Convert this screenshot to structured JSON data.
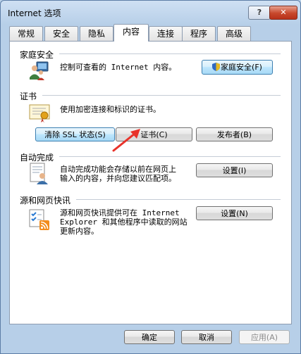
{
  "window": {
    "title": "Internet 选项"
  },
  "titlebar": {
    "help_glyph": "?",
    "close_glyph": "✕"
  },
  "tabs": [
    {
      "label": "常规"
    },
    {
      "label": "安全"
    },
    {
      "label": "隐私"
    },
    {
      "label": "内容",
      "active": true
    },
    {
      "label": "连接"
    },
    {
      "label": "程序"
    },
    {
      "label": "高级"
    }
  ],
  "sections": {
    "family_safety": {
      "title": "家庭安全",
      "description": "控制可查看的 Internet 内容。",
      "button": "家庭安全(F)",
      "icon": "family-safety-icon"
    },
    "certificates": {
      "title": "证书",
      "description": "使用加密连接和标识的证书。",
      "clear_ssl_button": "清除 SSL 状态(S)",
      "certificates_button": "证书(C)",
      "publishers_button": "发布者(B)",
      "icon": "certificate-icon"
    },
    "autocomplete": {
      "title": "自动完成",
      "description_line1": "自动完成功能会存储以前在网页上",
      "description_line2": "输入的内容，并向您建议匹配项。",
      "settings_button": "设置(I)",
      "icon": "autocomplete-icon"
    },
    "feeds": {
      "title": "源和网页快讯",
      "description_line1": "源和网页快讯提供可在 Internet",
      "description_line2": "Explorer 和其他程序中读取的网站",
      "description_line3": "更新内容。",
      "settings_button": "设置(N)",
      "icon": "feed-icon"
    }
  },
  "footer": {
    "ok_button": "确定",
    "cancel_button": "取消",
    "apply_button": "应用(A)"
  },
  "colors": {
    "accent": "#3c7fb1",
    "annotation_arrow": "#e8322a",
    "close_red": "#c7472b"
  }
}
